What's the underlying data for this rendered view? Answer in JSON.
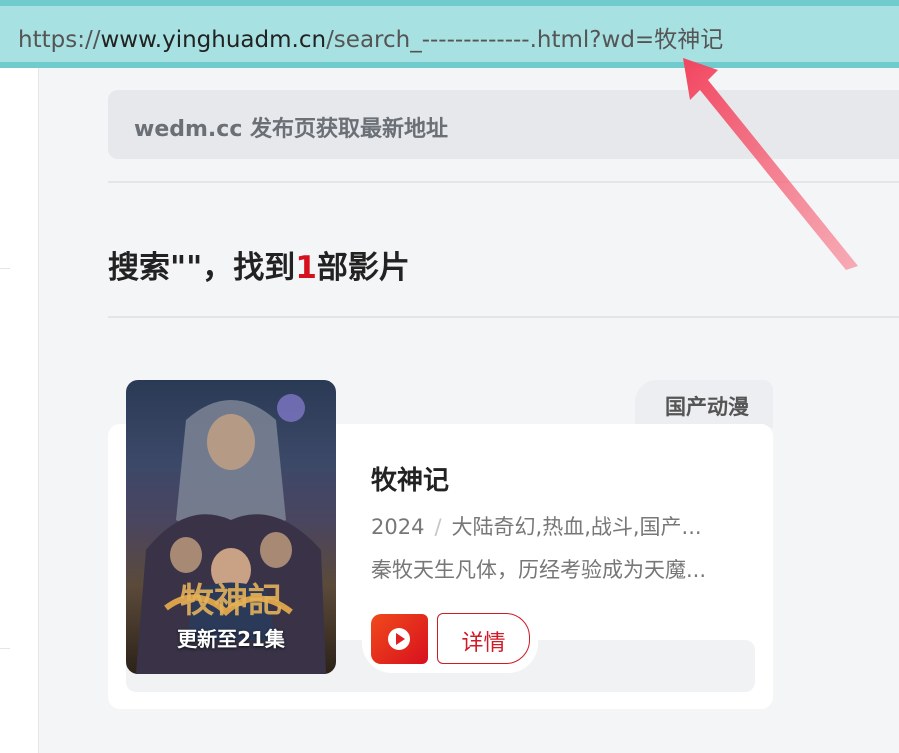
{
  "url_bar": {
    "scheme": "https://",
    "host": "www.yinghuadm.cn",
    "path": "/search_-------------.html?wd=牧神记"
  },
  "notice": {
    "text": "wedm.cc 发布页获取最新地址"
  },
  "search_result": {
    "prefix": "搜索\"\"，找到",
    "count": "1",
    "suffix": "部影片"
  },
  "result": {
    "category_tag": "国产动漫",
    "poster_badge": "更新至21集",
    "title": "牧神记",
    "year": "2024",
    "separator": "/",
    "genres": "大陆奇幻,热血,战斗,国产...",
    "description": "秦牧天生凡体，历经考验成为天魔...",
    "detail_label": "详情"
  },
  "colors": {
    "accent": "#d7101e",
    "url_bar": "#a8e1e2",
    "annotation_arrow": "#f4506a"
  },
  "icons": {
    "play": "play-icon",
    "arrow": "annotation-arrow"
  }
}
